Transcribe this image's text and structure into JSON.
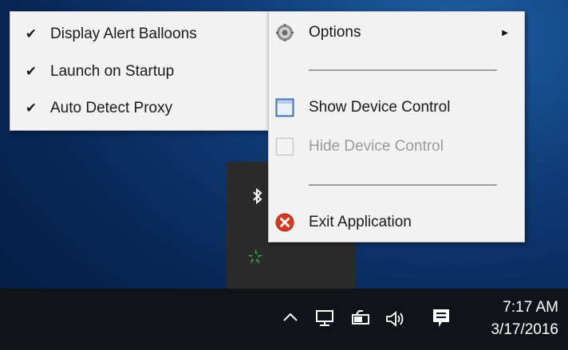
{
  "submenu": {
    "items": [
      {
        "label": "Display Alert Balloons",
        "checked": true
      },
      {
        "label": "Launch on Startup",
        "checked": true
      },
      {
        "label": "Auto Detect Proxy",
        "checked": true
      }
    ]
  },
  "main_menu": {
    "options_label": "Options",
    "show_device_control_label": "Show Device Control",
    "hide_device_control_label": "Hide Device Control",
    "exit_label": "Exit Application"
  },
  "tray": {
    "icons": [
      "bluetooth-icon",
      "green-app-icon"
    ]
  },
  "taskbar": {
    "clock_time": "7:17 AM",
    "clock_date": "3/17/2016",
    "icons": [
      "chevron-up-icon",
      "network-icon",
      "battery-icon",
      "volume-icon",
      "action-center-icon"
    ]
  },
  "colors": {
    "menu_bg": "#f2f2f2",
    "taskbar_bg": "#101418",
    "tray_bg": "#2b2b2b",
    "exit_red": "#d9381e",
    "green_icon": "#2fb34a"
  }
}
